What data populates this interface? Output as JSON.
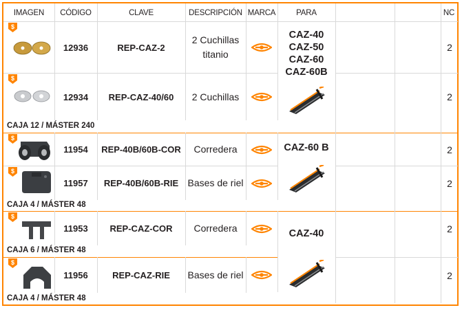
{
  "headers": {
    "imagen": "IMAGEN",
    "codigo": "CÓDIGO",
    "clave": "CLAVE",
    "descripcion": "DESCRIPCIÓN",
    "marca": "MARCA",
    "para": "PARA",
    "nc": "NC"
  },
  "rows": [
    {
      "codigo": "12936",
      "clave": "REP-CAZ-2",
      "desc_line1": "2 Cuchillas",
      "desc_line2": "titanio",
      "nc": "2",
      "image": "gold-cutting-wheels-icon"
    },
    {
      "codigo": "12934",
      "clave": "REP-CAZ-40/60",
      "desc_line1": "2 Cuchillas",
      "nc": "2",
      "image": "silver-cutting-wheels-icon"
    },
    {
      "codigo": "11954",
      "clave": "REP-40B/60B-COR",
      "desc_line1": "Corredera",
      "nc": "2",
      "image": "slider-carriage-icon"
    },
    {
      "codigo": "11957",
      "clave": "REP-40B/60B-RIE",
      "desc_line1": "Bases de riel",
      "nc": "2",
      "image": "rail-base-icon"
    },
    {
      "codigo": "11953",
      "clave": "REP-CAZ-COR",
      "desc_line1": "Corredera",
      "nc": "2",
      "image": "slider-bracket-icon"
    },
    {
      "codigo": "11956",
      "clave": "REP-CAZ-RIE",
      "desc_line1": "Bases de riel",
      "nc": "2",
      "image": "rail-bracket-icon"
    }
  ],
  "para_groups": [
    {
      "lines": [
        "CAZ-40",
        "CAZ-50",
        "CAZ-60",
        "CAZ-60B"
      ],
      "image": "tile-cutter-icon"
    },
    {
      "lines": [
        "CAZ-60 B"
      ],
      "image": "tile-cutter-icon"
    },
    {
      "lines": [
        "CAZ-40"
      ],
      "image": "tile-cutter-icon"
    }
  ],
  "cajas": [
    "CAJA 12 / MÁSTER 240",
    "CAJA 4 / MÁSTER 48",
    "CAJA 6 / MÁSTER 48",
    "CAJA 4 / MÁSTER 48"
  ],
  "badge_symbol": "$",
  "colors": {
    "accent": "#ff8400",
    "text": "#231f20",
    "grid": "#d9d9d9"
  }
}
